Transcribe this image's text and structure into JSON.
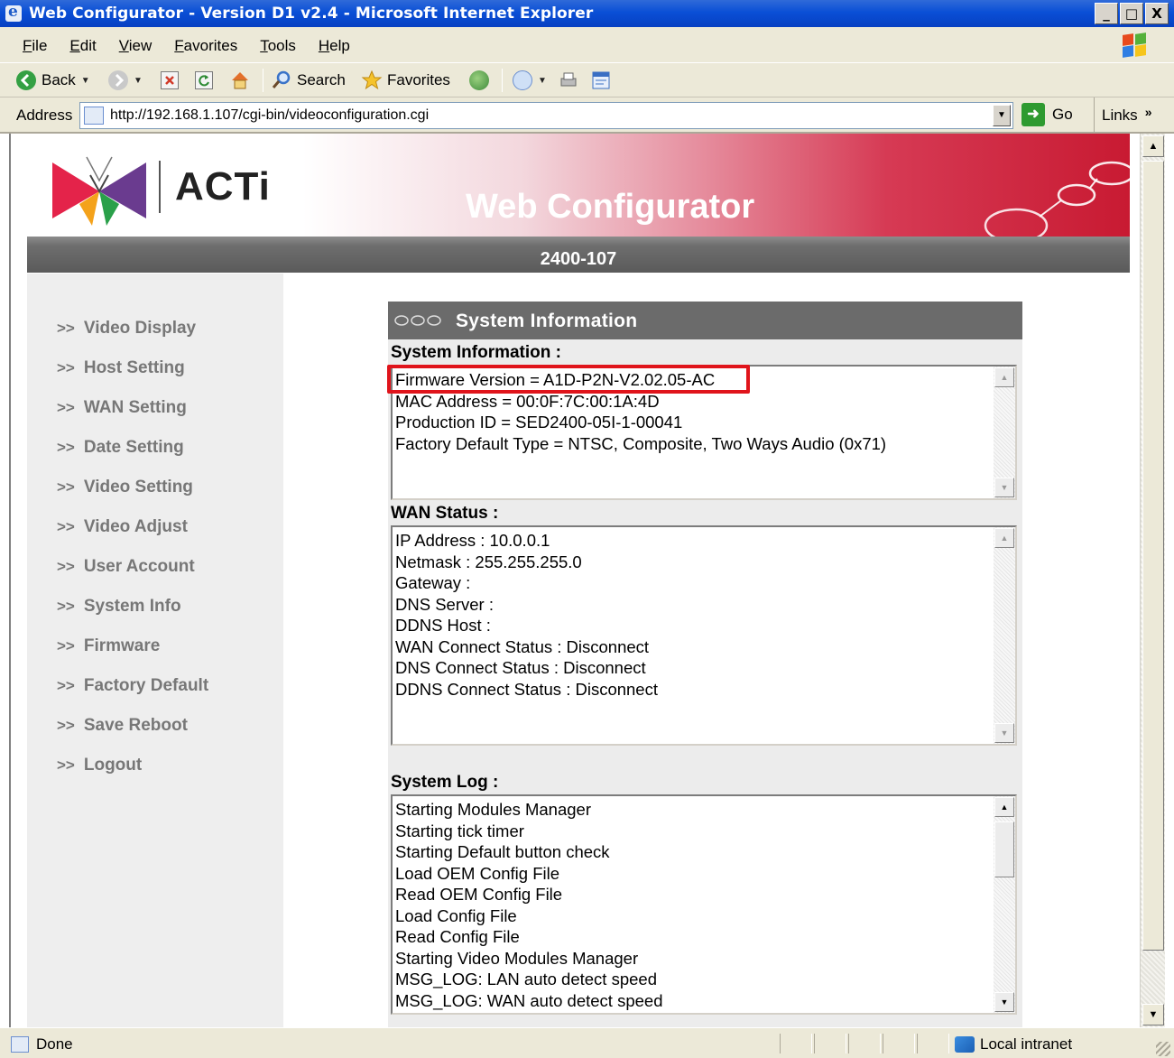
{
  "window": {
    "title": "Web Configurator - Version D1 v2.4 - Microsoft Internet Explorer",
    "buttons": {
      "minimize": "_",
      "maximize": "□",
      "close": "X"
    }
  },
  "menu": [
    "File",
    "Edit",
    "View",
    "Favorites",
    "Tools",
    "Help"
  ],
  "toolbar": {
    "back_label": "Back",
    "search_label": "Search",
    "favorites_label": "Favorites"
  },
  "address": {
    "label": "Address",
    "url": "http://192.168.1.107/cgi-bin/videoconfiguration.cgi",
    "go_label": "Go",
    "links_label": "Links",
    "links_chevron": "»"
  },
  "header": {
    "logo_text": "ACTi",
    "app_title": "Web Configurator",
    "model": "2400-107"
  },
  "sidebar": {
    "arrow": ">>",
    "items": [
      "Video Display",
      "Host Setting",
      "WAN Setting",
      "Date Setting",
      "Video Setting",
      "Video Adjust",
      "User Account",
      "System Info",
      "Firmware",
      "Factory Default",
      "Save Reboot",
      "Logout"
    ]
  },
  "panel": {
    "title": "System Information",
    "system_info": {
      "label": "System Information :",
      "lines": [
        "Firmware Version = A1D-P2N-V2.02.05-AC",
        "MAC Address = 00:0F:7C:00:1A:4D",
        "Production ID = SED2400-05I-1-00041",
        "Factory Default Type = NTSC, Composite, Two Ways Audio (0x71)"
      ]
    },
    "wan_status": {
      "label": "WAN Status :",
      "lines": [
        "IP Address : 10.0.0.1",
        "Netmask : 255.255.255.0",
        "Gateway :",
        "DNS Server :",
        "DDNS Host :",
        "WAN Connect Status : Disconnect",
        "DNS Connect Status : Disconnect",
        "DDNS Connect Status : Disconnect"
      ]
    },
    "system_log": {
      "label": "System Log :",
      "lines": [
        "Starting Modules Manager",
        "Starting tick timer",
        "Starting Default button check",
        "Load OEM Config File",
        "Read OEM Config File",
        "Load Config File",
        "Read Config File",
        "Starting Video Modules Manager",
        "MSG_LOG: LAN auto detect speed",
        "MSG_LOG: WAN auto detect speed"
      ]
    }
  },
  "status": {
    "text": "Done",
    "zone": "Local intranet"
  },
  "colors": {
    "highlight": "#e0141b",
    "header_red": "#c81a32",
    "panel_head": "#6b6b6b",
    "titlebar_blue": "#0a4fd6"
  }
}
